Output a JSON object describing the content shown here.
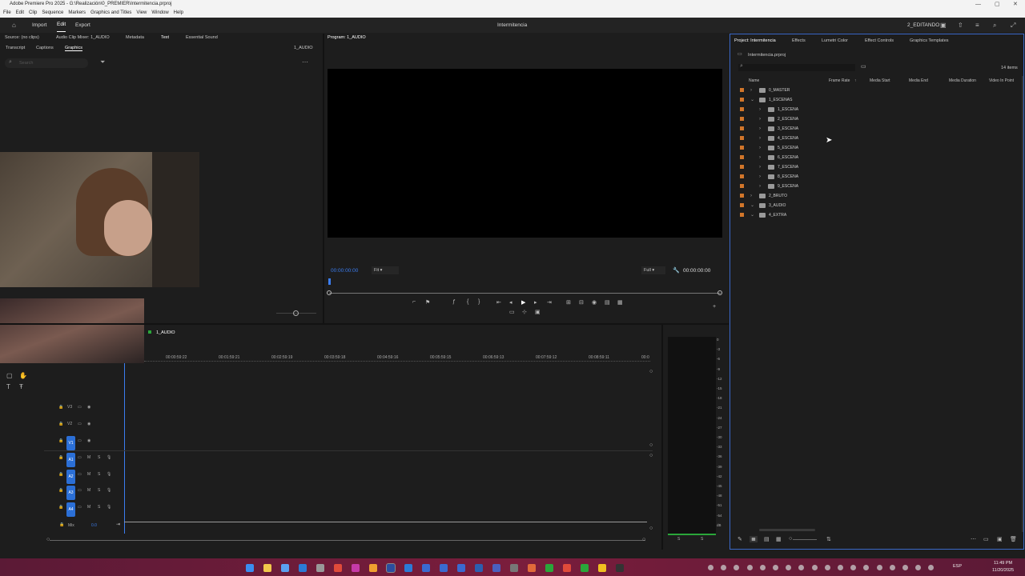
{
  "window": {
    "title": "Adobe Premiere Pro 2025 - G:\\Realización\\0_PREMIER\\Intermitencia.prproj"
  },
  "menu": [
    "File",
    "Edit",
    "Clip",
    "Sequence",
    "Markers",
    "Graphics and Titles",
    "View",
    "Window",
    "Help"
  ],
  "header": {
    "import": "Import",
    "edit": "Edit",
    "export": "Export",
    "project_title": "Intermitencia",
    "workspace": "2_EDITANDO"
  },
  "source_panel": {
    "tabs": [
      "Source: (no clips)",
      "Audio Clip Mixer: 1_AUDIO",
      "Metadata",
      "Text",
      "Essential Sound"
    ],
    "subtabs": [
      "Transcript",
      "Captions",
      "Graphics"
    ],
    "sequence": "1_AUDIO",
    "search_placeholder": "Search"
  },
  "program": {
    "tab": "Program: 1_AUDIO",
    "timecode_left": "00:00:00:00",
    "fit": "Fit",
    "quality": "Full",
    "timecode_right": "00:00:00:00"
  },
  "project": {
    "tabs": [
      "Project: Intermitencia",
      "Effects",
      "Lumetri Color",
      "Effect Controls",
      "Graphics Templates"
    ],
    "file": "Intermitencia.prproj",
    "count": "14 items",
    "columns": [
      "Name",
      "Frame Rate",
      "Media Start",
      "Media End",
      "Media Duration",
      "Video In Point"
    ],
    "rows": [
      {
        "name": "0_MASTER",
        "level": 0,
        "open": false
      },
      {
        "name": "1_ESCENAS",
        "level": 0,
        "open": true
      },
      {
        "name": "1_ESCENA",
        "level": 1,
        "open": false
      },
      {
        "name": "2_ESCENA",
        "level": 1,
        "open": false
      },
      {
        "name": "3_ESCENA",
        "level": 1,
        "open": false
      },
      {
        "name": "4_ESCENA",
        "level": 1,
        "open": false
      },
      {
        "name": "5_ESCENA",
        "level": 1,
        "open": false
      },
      {
        "name": "6_ESCENA",
        "level": 1,
        "open": false
      },
      {
        "name": "7_ESCENA",
        "level": 1,
        "open": false
      },
      {
        "name": "8_ESCENA",
        "level": 1,
        "open": false
      },
      {
        "name": "9_ESCENA",
        "level": 1,
        "open": false
      },
      {
        "name": "2_BRUTO",
        "level": 0,
        "open": false
      },
      {
        "name": "3_AUDIO",
        "level": 0,
        "open": true
      },
      {
        "name": "4_EXTRA",
        "level": 0,
        "open": true
      }
    ]
  },
  "timeline": {
    "tab": "1_AUDIO",
    "ruler": [
      "00:00:59:22",
      "00:01:59:21",
      "00:02:59:19",
      "00:03:59:18",
      "00:04:59:16",
      "00:05:59:15",
      "00:06:59:13",
      "00:07:59:12",
      "00:08:59:11",
      "00:0"
    ],
    "video_tracks": [
      "V3",
      "V2",
      "V1"
    ],
    "audio_tracks": [
      "A1",
      "A2",
      "A3",
      "A4"
    ],
    "mix": "Mix",
    "mix_value": "0.0"
  },
  "meter": {
    "ticks": [
      "0",
      "-3",
      "-6",
      "-9",
      "-12",
      "-15",
      "-18",
      "-21",
      "-24",
      "-27",
      "-30",
      "-33",
      "-36",
      "-39",
      "-42",
      "-45",
      "-48",
      "-51",
      "-54",
      "dB"
    ],
    "bottom": [
      "S",
      "S"
    ]
  },
  "taskbar": {
    "lang": "ESP",
    "time": "11:49 PM",
    "date": "11/20/2025"
  }
}
